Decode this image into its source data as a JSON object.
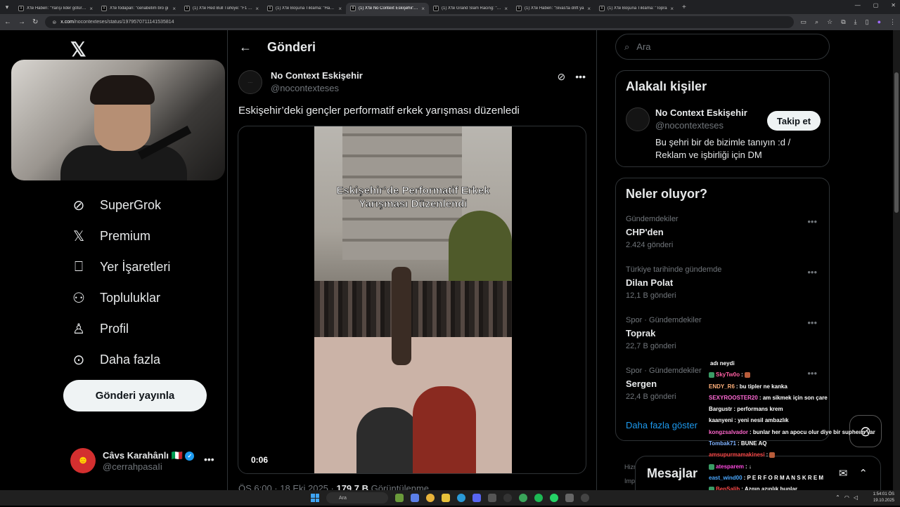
{
  "browser": {
    "tabs": [
      {
        "label": "X'te Haberi: \"Yarışı lider götürür\"",
        "active": false
      },
      {
        "label": "X'te fodapan: \"cenabetim bro gi",
        "active": false
      },
      {
        "label": "(1) X'te Red Bull Türkiye: \"F1 #S",
        "active": false
      },
      {
        "label": "(1) X'te Boşuna Tıklama: \"Hamo",
        "active": false
      },
      {
        "label": "(1) X'te No Context Eskişehir: \"E",
        "active": true
      },
      {
        "label": "(1) X'te Grand Slam Racing: \"SE",
        "active": false
      },
      {
        "label": "(1) X'te Haberi: \"Sivas'ta drift ya",
        "active": false
      },
      {
        "label": "(1) X'te Boşuna Tıklama: \"Topra",
        "active": false
      }
    ],
    "url_domain": "x.com",
    "url_path": "/nocontexteses/status/1979570711141535814"
  },
  "nav": {
    "items": [
      {
        "label": "SuperGrok",
        "icon": "grok-icon"
      },
      {
        "label": "Premium",
        "icon": "x-icon"
      },
      {
        "label": "Yer İşaretleri",
        "icon": "bookmark-icon"
      },
      {
        "label": "Topluluklar",
        "icon": "communities-icon"
      },
      {
        "label": "Profil",
        "icon": "profile-icon"
      },
      {
        "label": "Daha fazla",
        "icon": "more-circle-icon"
      }
    ],
    "post_button": "Gönderi yayınla",
    "account": {
      "name": "Câvs Karahânlı 🇮🇹",
      "handle": "@cerrahpasaIi"
    }
  },
  "main": {
    "header_title": "Gönderi",
    "tweet": {
      "author_name": "No Context Eskişehir",
      "author_handle": "@nocontexteses",
      "text": "Eskişehir’deki gençler performatif erkek yarışması düzenledi",
      "video_caption": "Eskişehir’de Performatif Erkek Yarışması Düzenlendi",
      "video_time": "0:06",
      "meta_time": "ÖS 6:00 · 18 Eki 2025 · ",
      "meta_views": "179,7 B",
      "meta_views_label": " Görüntülenme"
    }
  },
  "sidebar": {
    "search_placeholder": "Ara",
    "related": {
      "title": "Alakalı kişiler",
      "name": "No Context Eskişehir",
      "handle": "@nocontexteses",
      "bio": "Bu şehri bir de bizimle tanıyın :d / Reklam ve işbirliği için DM",
      "follow_label": "Takip et"
    },
    "trends": {
      "title": "Neler oluyor?",
      "items": [
        {
          "context": "Gündemdekiler",
          "name": "CHP'den",
          "count": "2.424 gönderi"
        },
        {
          "context": "Türkiye tarihinde gündemde",
          "name": "Dilan Polat",
          "count": "12,1 B gönderi"
        },
        {
          "context": "Spor · Gündemdekiler",
          "name": "Toprak",
          "count": "22,7 B gönderi"
        },
        {
          "context": "Spor · Gündemdekiler",
          "name": "Sergen",
          "count": "22,4 B gönderi"
        }
      ],
      "show_more": "Daha fazla göster"
    },
    "legal_1": "Hizm",
    "legal_2": "Imp",
    "legal_3": "© 2",
    "messages_label": "Mesajlar"
  },
  "chat": {
    "messages": [
      {
        "user": "",
        "text": "adı neydi",
        "color": "#ffffff"
      },
      {
        "user": "SkyTw0o",
        "text": ": ",
        "color": "#ff5fa2"
      },
      {
        "user": "ENDY_R6",
        "text": ": bu tipler ne kanka",
        "color": "#ffb07a"
      },
      {
        "user": "SEXYROOSTER20",
        "text": ": am sikmek için son çare",
        "color": "#ff6ad5"
      },
      {
        "user": "Bargustr",
        "text": ": performans krem",
        "color": "#ffffff"
      },
      {
        "user": "kaanyeni",
        "text": ": yeni nesil ambazlık",
        "color": "#ffffff"
      },
      {
        "user": "kongzsalvador",
        "text": ": bunlar her an apocu olur diye bir supheım var",
        "color": "#ff66cc"
      },
      {
        "user": "Tombak71",
        "text": ": BUNE AQ",
        "color": "#7fb2ff"
      },
      {
        "user": "amsupurmamakinesi",
        "text": ": ",
        "color": "#ff4a4a"
      },
      {
        "user": "atesparem",
        "text": ": ↓",
        "color": "#ff4ae0"
      },
      {
        "user": "east_wind00",
        "text": ": P E R F O R M A N S K R E M",
        "color": "#4aa8ff"
      },
      {
        "user": "BenSalih",
        "text": ": Azgın azınlık bunlar",
        "color": "#ff4a4a"
      },
      {
        "user": "lay",
        "text": ": ",
        "color": "#4aa8ff"
      }
    ]
  },
  "taskbar": {
    "search_label": "Ara",
    "time": "1:54:01 ÖS",
    "date": "19.10.2025"
  }
}
